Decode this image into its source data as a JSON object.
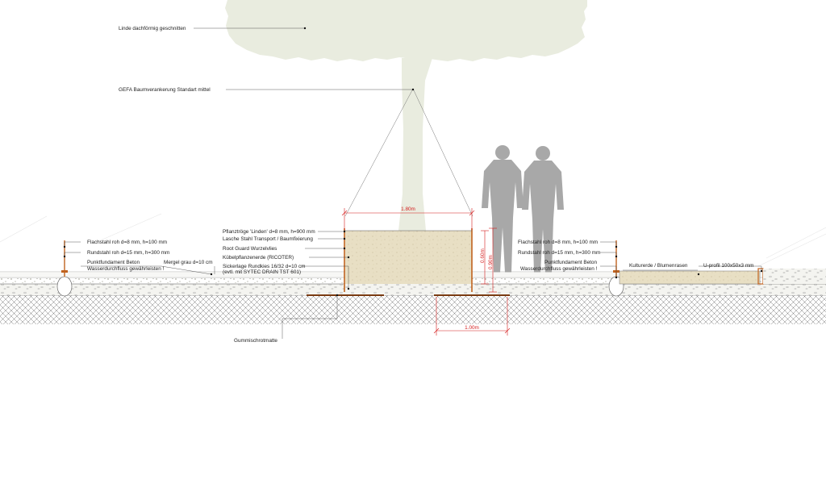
{
  "labels": {
    "linde": "Linde dachförmig geschnitten",
    "gefa": "GEFA Baumverankerung Standart mittel",
    "pflanztroege": "Pflanztröge 'Linden' d=8 mm, h=900 mm",
    "lasche": "Lasche Stahl Transport / Baumfixierung",
    "root_guard": "Root Guard Wurzelvlies",
    "kuebel": "Kübelpflanzenerde (RICOTER)",
    "sicker_1": "Sickerlage Rundkies 16/32 d=10 cm",
    "sicker_2": "(evtl. mit SYTEC DRAIN TST 601)",
    "gummi": "Gummischrotmatte",
    "flach_left": "Flachstahl roh d=8 mm, h=100 mm",
    "rund_left": "Rundstahl roh d=15 mm, h=300 mm",
    "punkt_left_1": "Punktfundament Beton",
    "punkt_left_2": "Wasserdurchfluss gewährleisten !",
    "mergel": "Mergel grau d=10 cm",
    "flach_right": "Flachstahl roh d=8 mm, h=100 mm",
    "rund_right": "Rundstahl roh d=15 mm, h=300 mm",
    "punkt_right_1": "Punktfundament Beton",
    "punkt_right_2": "Wasserdurchfluss gewährleisten !",
    "kulturerde": "Kulturerde / Blumenrasen",
    "uprofil": "U-profil 100x50x3 mm"
  },
  "dimensions": {
    "width_top": "1.80m",
    "width_bottom": "1.00m",
    "height_box": "0.60m",
    "height_total": "0.90m"
  },
  "colors": {
    "tree": "#e9ecdf",
    "figure": "#a8a8a8",
    "soil": "#e6dcc0",
    "steel": "#c0621e",
    "dimension": "#d41c1c",
    "crosshatch": "#555555"
  }
}
